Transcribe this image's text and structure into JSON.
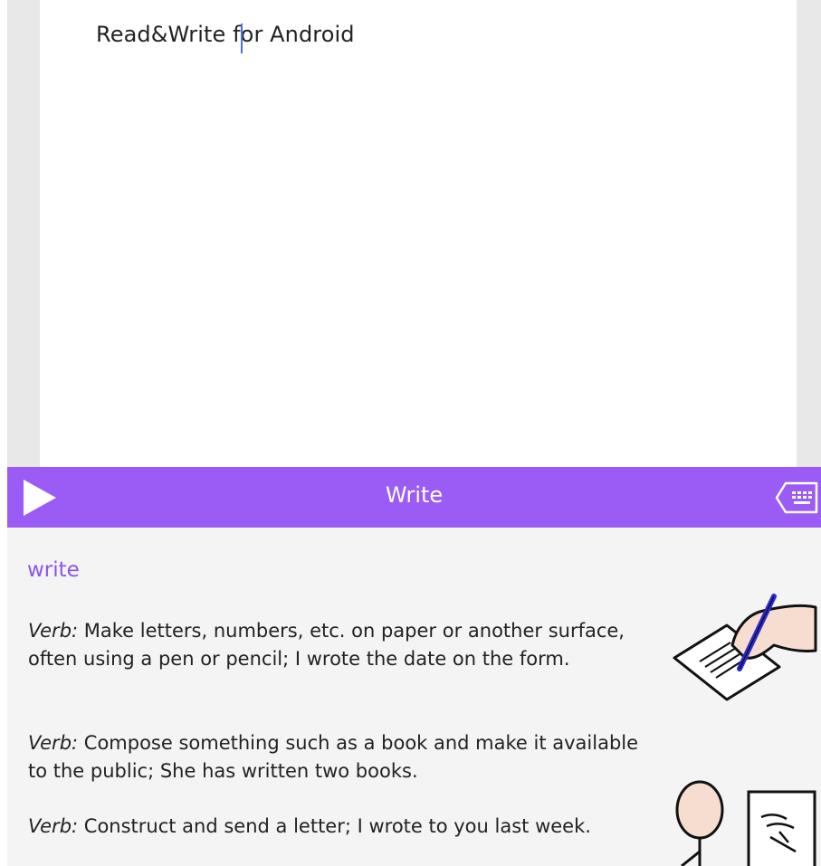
{
  "colors": {
    "accent": "#9b5cf6",
    "accent_text": "#8b55e8"
  },
  "document": {
    "text": "Read&Write for Android"
  },
  "toolbar": {
    "title": "Write",
    "play_icon": "play-icon",
    "keyboard_icon": "keyboard-icon"
  },
  "dictionary": {
    "headword": "write",
    "definitions": [
      {
        "pos": "Verb:",
        "text": " Make letters, numbers, etc. on paper or another surface, often using a pen or pencil; I wrote the date on the form."
      },
      {
        "pos": "Verb:",
        "text": " Compose something such as a book and make it available to the public; She has written two books."
      },
      {
        "pos": "Verb:",
        "text": " Construct and send a letter; I wrote to you last week."
      }
    ]
  }
}
